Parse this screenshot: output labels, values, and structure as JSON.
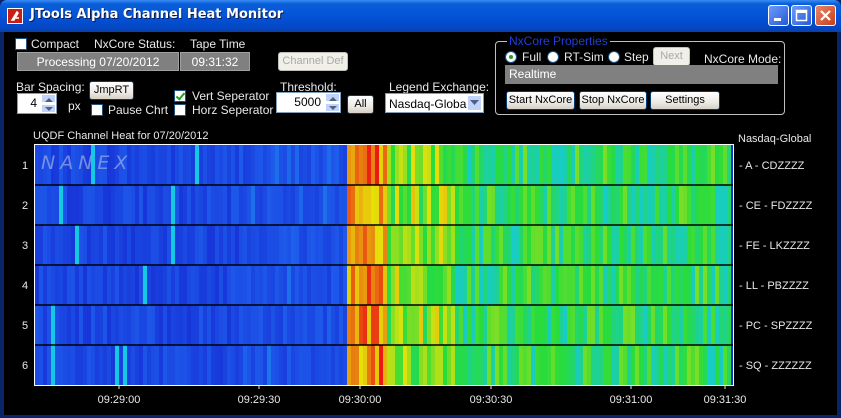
{
  "window": {
    "title": "JTools Alpha Channel Heat Monitor",
    "controls": {
      "minimize": "minimize-icon",
      "maximize": "maximize-icon",
      "close": "close-icon"
    }
  },
  "toolbar": {
    "compact_label": "Compact",
    "compact_checked": false,
    "nxcore_status_label": "NxCore Status:",
    "nxcore_status_value": "Processing 07/20/2012",
    "tape_time_label": "Tape Time",
    "tape_time_value": "09:31:32",
    "channel_def_label": "Channel Def",
    "bar_spacing_label": "Bar Spacing:",
    "bar_spacing_value": "4",
    "bar_spacing_unit": "px",
    "jmprt_label": "JmpRT",
    "pause_chart_label": "Pause Chrt",
    "pause_chart_checked": false,
    "vert_sep_label": "Vert Seperator",
    "vert_sep_checked": true,
    "horz_sep_label": "Horz Seperator",
    "horz_sep_checked": false,
    "threshold_label": "Threshold:",
    "threshold_value": "5000",
    "all_label": "All",
    "legend_exchange_label": "Legend Exchange:",
    "legend_exchange_value": "Nasdaq-Global"
  },
  "nxcore_group": {
    "title": "NxCore Properties",
    "radio_full": "Full",
    "radio_rtsim": "RT-Sim",
    "radio_step": "Step",
    "selected": "Full",
    "next_label": "Next",
    "mode_label": "NxCore Mode:",
    "mode_value": "Realtime",
    "start_label": "Start NxCore",
    "stop_label": "Stop NxCore",
    "settings_label": "Settings"
  },
  "chart": {
    "title": "UQDF Channel Heat for 07/20/2012",
    "legend_exchange": "Nasdaq-Global",
    "watermark": "NANEX",
    "colors": {
      "cold": "#1a2fd0",
      "mid": "#10d0e0",
      "warm": "#30e030",
      "hot": "#e8e000",
      "peak": "#e81010"
    }
  },
  "chart_data": {
    "type": "heatmap",
    "title": "UQDF Channel Heat for 07/20/2012",
    "rows": [
      {
        "row": "1",
        "channel": "A - CDZZZZ"
      },
      {
        "row": "2",
        "channel": "CE - FDZZZZ"
      },
      {
        "row": "3",
        "channel": "FE - LKZZZZ"
      },
      {
        "row": "4",
        "channel": "LL - PBZZZZ"
      },
      {
        "row": "5",
        "channel": "PC - SPZZZZ"
      },
      {
        "row": "6",
        "channel": "SQ - ZZZZZZ"
      }
    ],
    "x_ticks": [
      "09:29:00",
      "09:29:30",
      "09:30:00",
      "09:30:30",
      "09:31:00",
      "09:31:30"
    ],
    "x_range": [
      "09:28:43",
      "09:31:32"
    ],
    "legend": "Nasdaq-Global",
    "color_scale": [
      "blue",
      "cyan",
      "green",
      "yellow",
      "red"
    ]
  }
}
